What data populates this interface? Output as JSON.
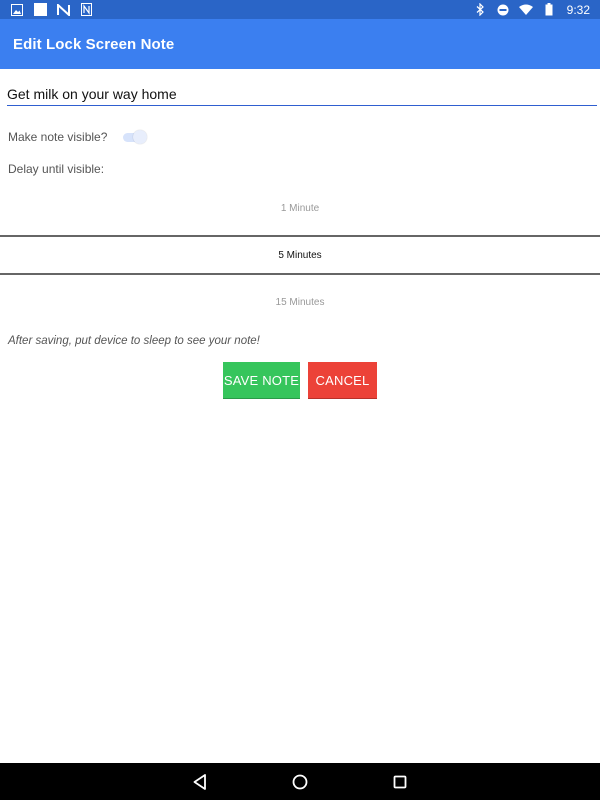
{
  "status_bar": {
    "left_icons": [
      "gallery-icon",
      "square-notification-icon",
      "n-notification-icon",
      "file-icon"
    ],
    "right_icons": [
      "bluetooth-icon",
      "do-not-disturb-icon",
      "wifi-icon",
      "battery-icon"
    ],
    "time": "9:32"
  },
  "app_bar": {
    "title": "Edit Lock Screen Note",
    "color": "#3b7ff0"
  },
  "note": {
    "value": "Get milk on your way home"
  },
  "visibility": {
    "label": "Make note visible?",
    "enabled": true
  },
  "delay": {
    "label": "Delay until visible:",
    "options": [
      "1 Minute",
      "5 Minutes",
      "15 Minutes"
    ],
    "selected": "5 Minutes"
  },
  "hint": "After saving, put device to sleep to see your note!",
  "buttons": {
    "save_label": "SAVE NOTE",
    "cancel_label": "CANCEL",
    "save_color": "#36c55c",
    "cancel_color": "#ec4238"
  },
  "nav_bar": {
    "icons": [
      "back-icon",
      "home-icon",
      "recents-icon"
    ]
  }
}
